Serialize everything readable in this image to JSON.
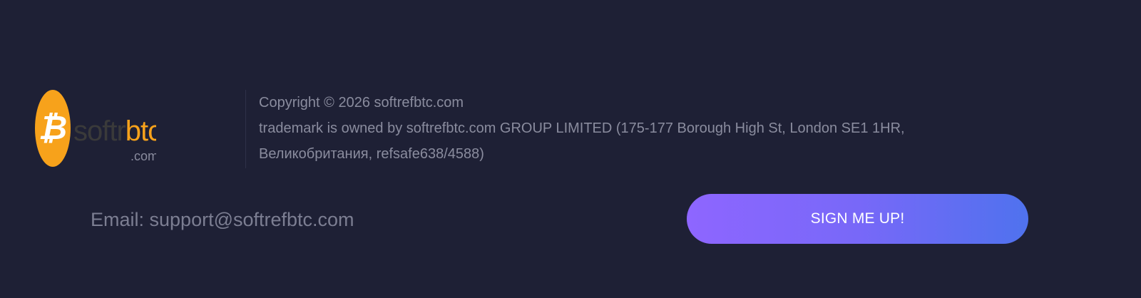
{
  "footer": {
    "logo": {
      "wordmark_prefix": "softr",
      "wordmark_accent": "btc",
      "tld": ".com",
      "coin_glyph": "₿",
      "colors": {
        "coin": "#f7a21b",
        "accent": "#f7a21b",
        "prefix": "#3a3a3a",
        "tld": "#8a8c9e"
      }
    },
    "legal": {
      "copyright": "Copyright © 2026 softrefbtc.com",
      "trademark_line1": "trademark is owned by softrefbtc.com GROUP LIMITED (175-177 Borough High St, London SE1 1HR,",
      "trademark_line2": "Великобритания, refsafe638/4588)"
    },
    "email": "Email: support@softrefbtc.com",
    "signup_button": "SIGN ME UP!",
    "colors": {
      "background": "#1e2035",
      "text": "#8a8c9e",
      "button_gradient_start": "#8e66ff",
      "button_gradient_end": "#4f72ee"
    }
  }
}
